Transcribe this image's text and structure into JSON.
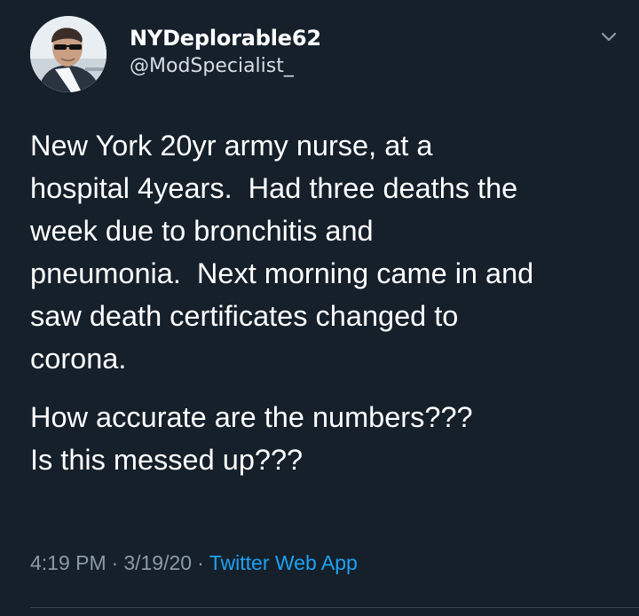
{
  "tweet": {
    "author": {
      "display_name": "NYDeplorable62",
      "handle": "@ModSpecialist_"
    },
    "body": {
      "lines": [
        "New York 20yr army nurse, at a",
        "hospital 4years.  Had three deaths the",
        "week due to bronchitis and",
        "pneumonia.  Next morning came in and",
        "saw death certificates changed to",
        "corona."
      ],
      "lines2": [
        "How accurate are the numbers???",
        "Is this messed up???"
      ]
    },
    "meta": {
      "time": "4:19 PM",
      "separator": "·",
      "date": "3/19/20",
      "source": "Twitter Web App"
    },
    "icons": {
      "caret": "chevron-down-icon",
      "avatar": "profile-avatar"
    },
    "colors": {
      "background": "#15202b",
      "link": "#1da1f2",
      "secondary_text": "#8c99a6"
    }
  }
}
